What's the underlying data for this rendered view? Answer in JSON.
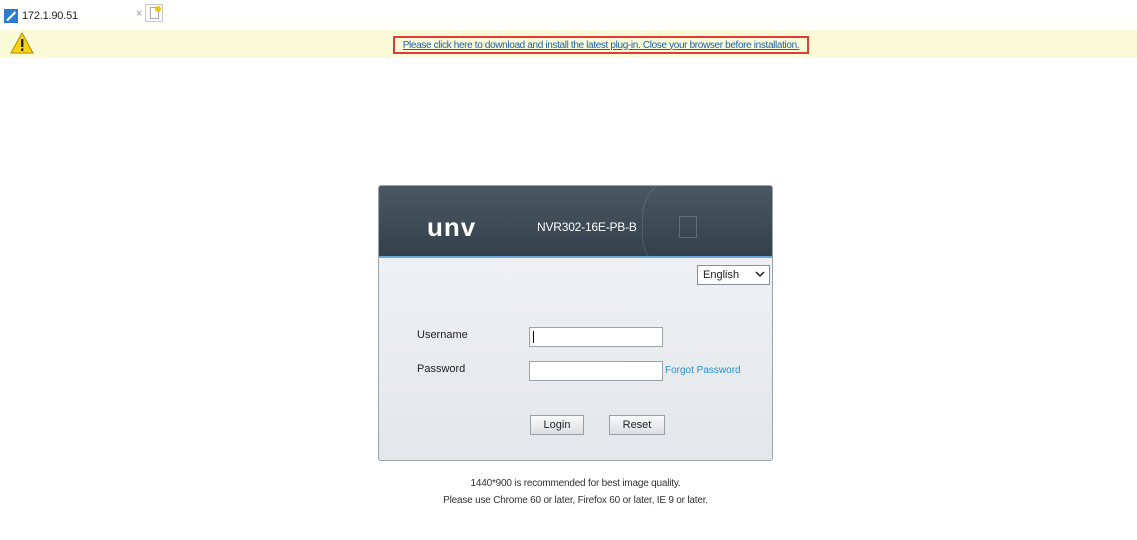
{
  "browser": {
    "tab_title": "172.1.90.51",
    "tab_close": "×"
  },
  "infobar": {
    "plugin_link": "Please click here to download and install the latest plug-in. Close your browser before installation.",
    "highlight_color": "#e43a3a"
  },
  "login": {
    "logo": "unv",
    "model": "NVR302-16E-PB-B",
    "language_selected": "English",
    "username_label": "Username",
    "username_value": "",
    "password_label": "Password",
    "password_value": "",
    "forgot_password": "Forgot Password",
    "login_button": "Login",
    "reset_button": "Reset"
  },
  "footer": {
    "line1": "1440*900 is recommended for best image quality.",
    "line2": "Please use Chrome 60 or later, Firefox 60 or later, IE 9 or later."
  },
  "icons": {
    "favicon": "ie-tab-icon",
    "warning": "warning-triangle-icon",
    "newtab": "new-tab-icon",
    "dropdown": "chevron-down-icon"
  },
  "colors": {
    "header_bg": "#3e4a55",
    "accent": "#69a8d6",
    "link": "#2a8fd6",
    "infobar_bg": "#fcfbd7"
  }
}
